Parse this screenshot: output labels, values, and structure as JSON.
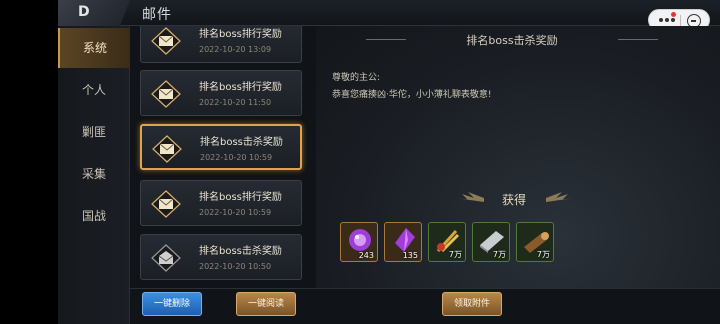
{
  "header": {
    "title": "邮件",
    "back_label": "D"
  },
  "sidebar": {
    "items": [
      {
        "label": "系统",
        "active": true
      },
      {
        "label": "个人",
        "active": false
      },
      {
        "label": "剿匪",
        "active": false
      },
      {
        "label": "采集",
        "active": false
      },
      {
        "label": "国战",
        "active": false
      }
    ]
  },
  "mails": [
    {
      "title": "排名boss排行奖励",
      "date": "2022-10-20  13:09",
      "read": false,
      "selected": false
    },
    {
      "title": "排名boss排行奖励",
      "date": "2022-10-20  11:50",
      "read": false,
      "selected": false
    },
    {
      "title": "排名boss击杀奖励",
      "date": "2022-10-20  10:59",
      "read": false,
      "selected": true
    },
    {
      "title": "排名boss排行奖励",
      "date": "2022-10-20  10:59",
      "read": false,
      "selected": false
    },
    {
      "title": "排名boss击杀奖励",
      "date": "2022-10-20  10:50",
      "read": true,
      "selected": false
    }
  ],
  "detail": {
    "title": "排名boss击杀奖励",
    "greeting": "尊敬的主公:",
    "body": "恭喜您痛揍凶·华佗，小小薄礼聊表敬意!",
    "reward_label": "获得",
    "rewards": [
      {
        "icon": "purple-orb-icon",
        "count": "243",
        "frame": "orange"
      },
      {
        "icon": "purple-crystal-icon",
        "count": "135",
        "frame": "orange"
      },
      {
        "icon": "grain-bundle-icon",
        "count": "7万",
        "frame": "green"
      },
      {
        "icon": "iron-ingot-icon",
        "count": "7万",
        "frame": "green"
      },
      {
        "icon": "wood-log-icon",
        "count": "7万",
        "frame": "green"
      }
    ]
  },
  "actions": {
    "delete_all": "一键删除",
    "read_all": "一键阅读",
    "claim": "领取附件"
  },
  "colors": {
    "accent_gold": "#e0a24a",
    "button_blue": "#2f7fd0"
  }
}
